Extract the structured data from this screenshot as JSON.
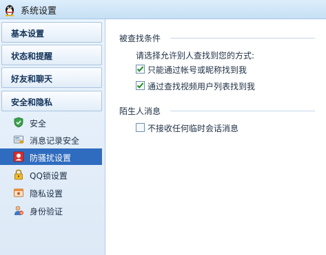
{
  "window": {
    "title": "系统设置",
    "icon": "qq-penguin-icon"
  },
  "sidebar": {
    "headers": [
      {
        "label": "基本设置"
      },
      {
        "label": "状态和提醒"
      },
      {
        "label": "好友和聊天"
      },
      {
        "label": "安全和隐私"
      }
    ],
    "items": [
      {
        "label": "安全",
        "icon": "shield-icon",
        "active": false
      },
      {
        "label": "消息记录安全",
        "icon": "message-log-icon",
        "active": false
      },
      {
        "label": "防骚扰设置",
        "icon": "anti-harass-icon",
        "active": true
      },
      {
        "label": "QQ锁设置",
        "icon": "lock-icon",
        "active": false
      },
      {
        "label": "隐私设置",
        "icon": "privacy-icon",
        "active": false
      },
      {
        "label": "身份验证",
        "icon": "user-verify-icon",
        "active": false
      }
    ]
  },
  "content": {
    "find_section": {
      "title": "被查找条件",
      "description": "请选择允许别人查找到您的方式:",
      "options": [
        {
          "label": "只能通过帐号或昵称找到我",
          "checked": true
        },
        {
          "label": "通过查找视频用户列表找到我",
          "checked": true
        }
      ]
    },
    "stranger_section": {
      "title": "陌生人消息",
      "options": [
        {
          "label": "不接收任何临时会话消息",
          "checked": false
        }
      ]
    }
  },
  "colors": {
    "active_item_bg": "#2f6cc0",
    "checkmark": "#1f8a1f"
  }
}
